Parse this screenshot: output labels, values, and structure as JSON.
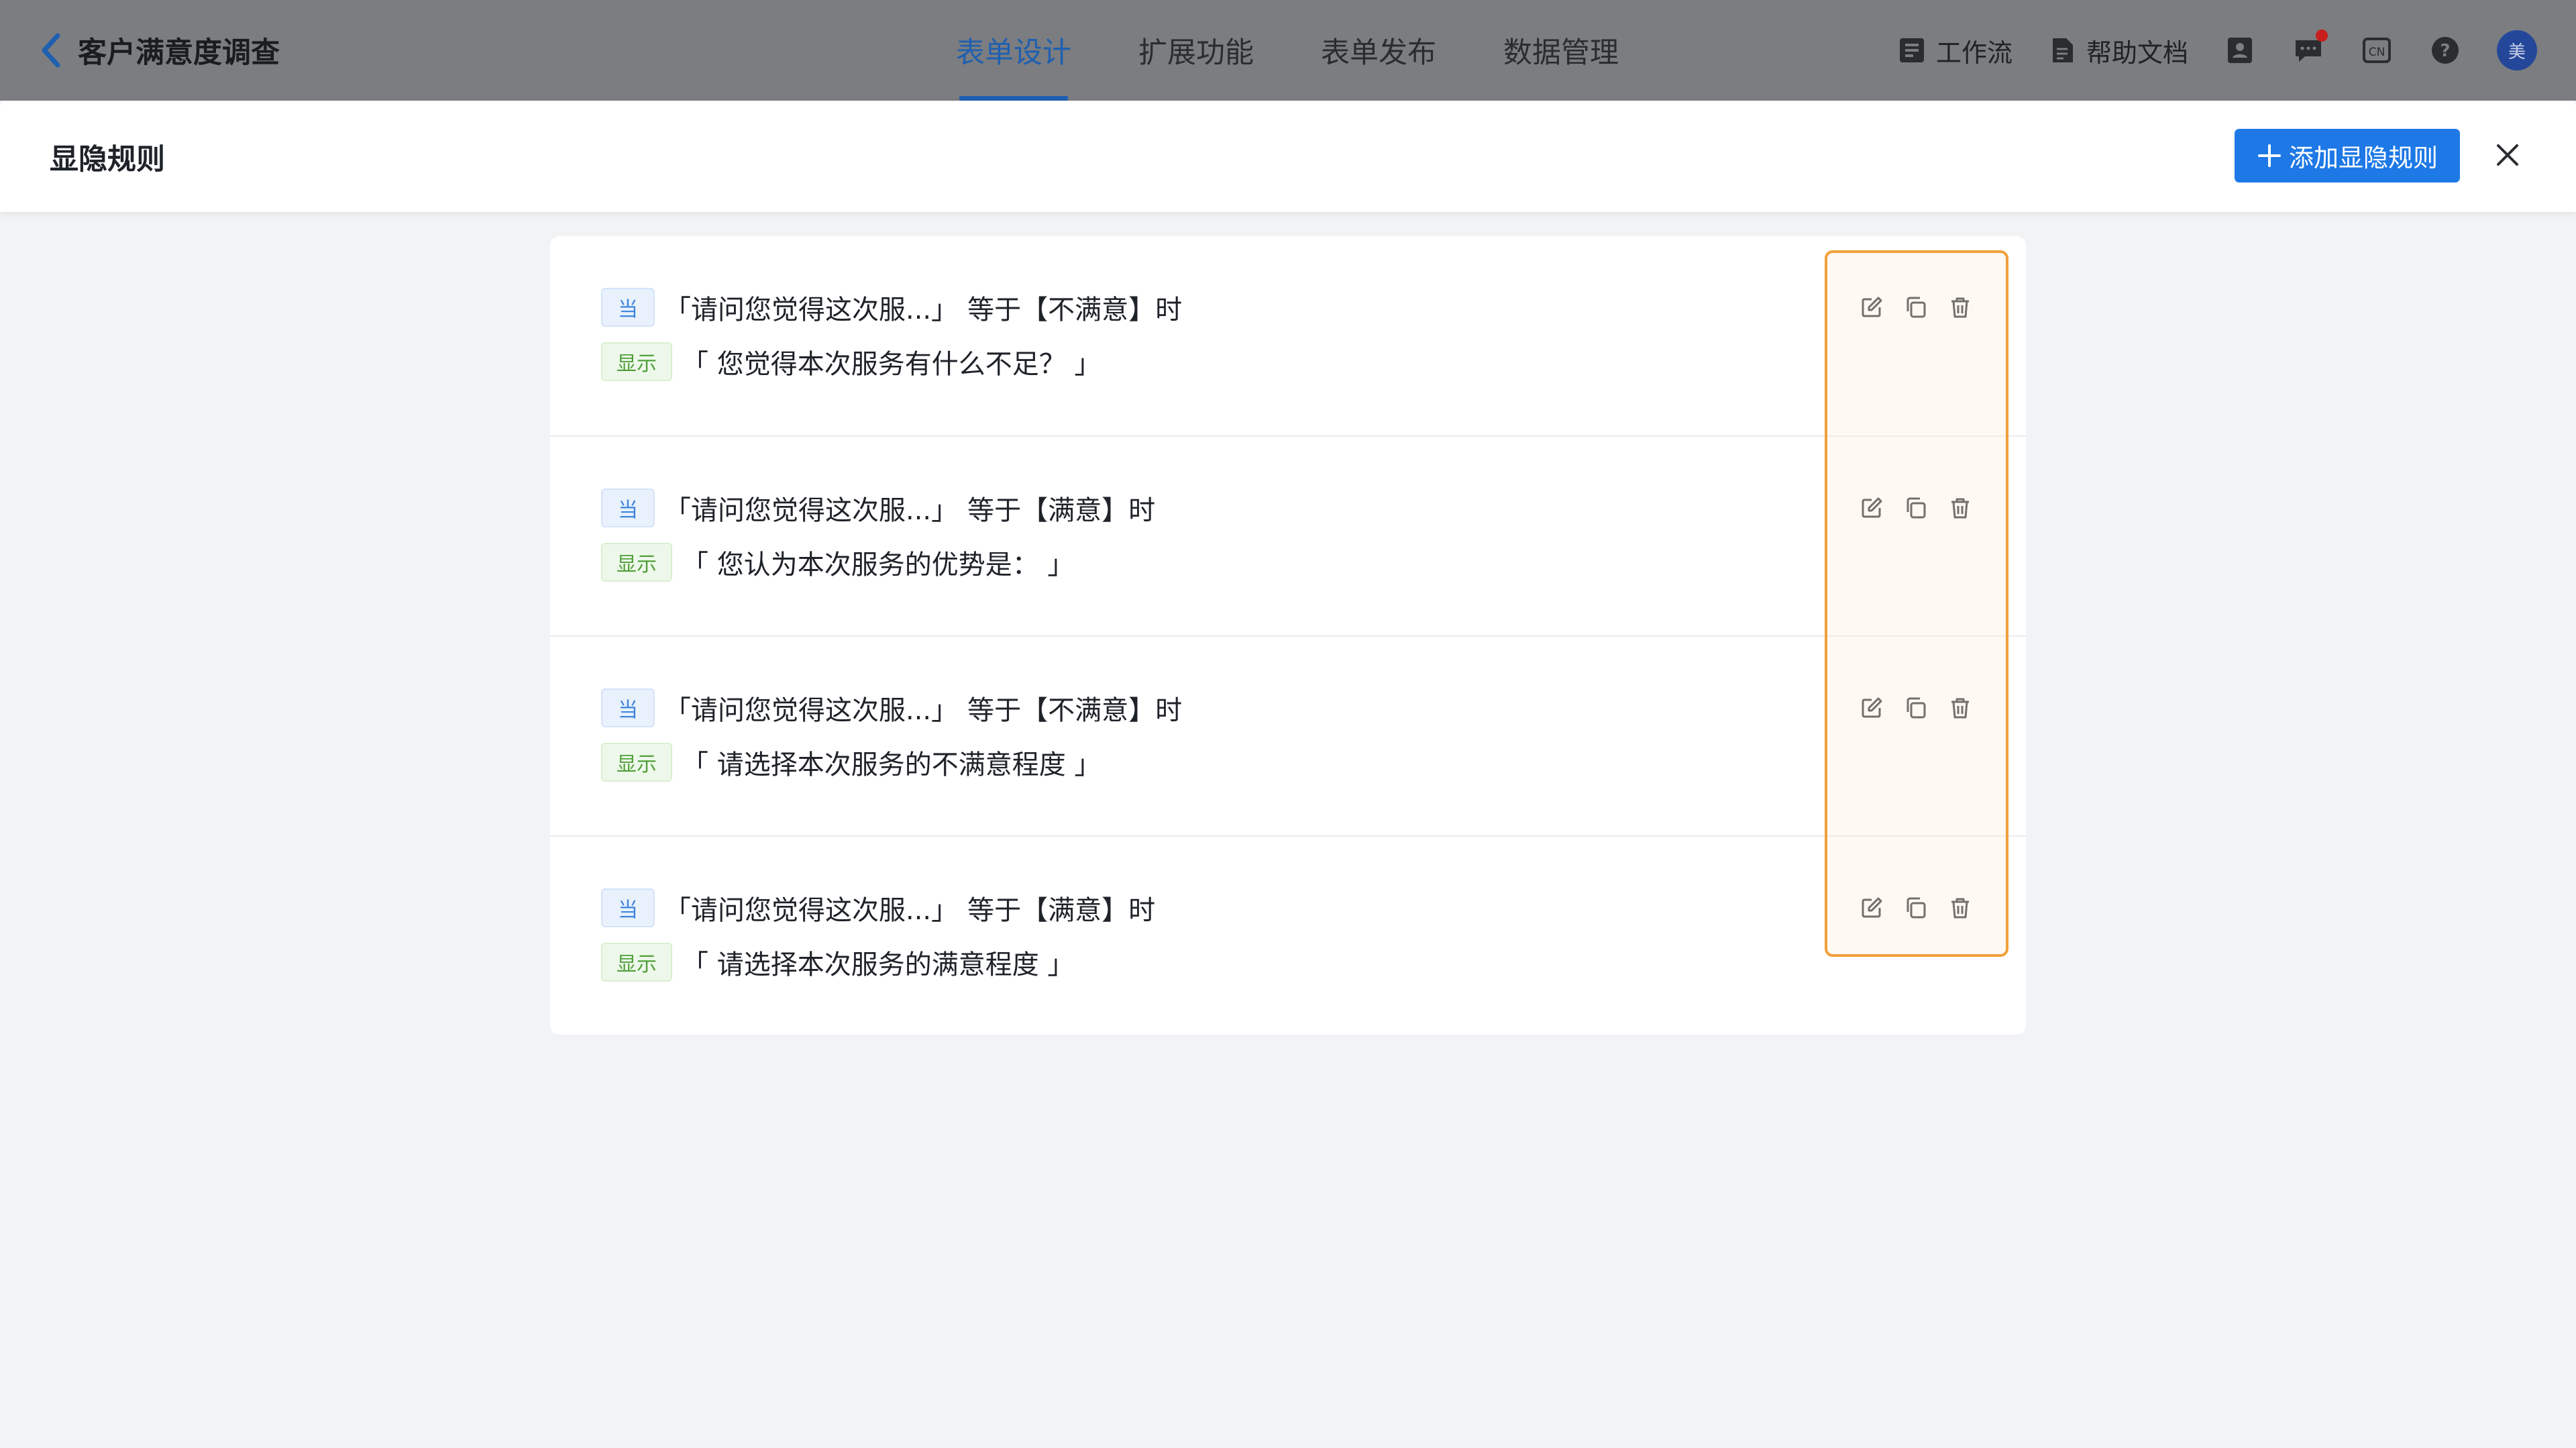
{
  "header": {
    "title": "客户满意度调查",
    "tabs": [
      {
        "label": "表单设计",
        "active": true
      },
      {
        "label": "扩展功能",
        "active": false
      },
      {
        "label": "表单发布",
        "active": false
      },
      {
        "label": "数据管理",
        "active": false
      }
    ],
    "workflow_label": "工作流",
    "help_label": "帮助文档",
    "lang_label": "CN",
    "avatar_label": "美"
  },
  "drawer": {
    "title": "显隐规则",
    "add_button_label": "添加显隐规则"
  },
  "colors": {
    "primary": "#1e79e6",
    "highlight": "#f2a03a",
    "when_tag": "#3f86dd",
    "show_tag": "#4fa03a"
  },
  "rules": [
    {
      "when": "当",
      "field": "「请问您觉得这次服...」",
      "operator": "等于",
      "value": "【不满意】时",
      "show": "显示",
      "target": "「 您觉得本次服务有什么不足？ 」"
    },
    {
      "when": "当",
      "field": "「请问您觉得这次服...」",
      "operator": "等于",
      "value": "【满意】时",
      "show": "显示",
      "target": "「 您认为本次服务的优势是： 」"
    },
    {
      "when": "当",
      "field": "「请问您觉得这次服...」",
      "operator": "等于",
      "value": "【不满意】时",
      "show": "显示",
      "target": "「 请选择本次服务的不满意程度 」"
    },
    {
      "when": "当",
      "field": "「请问您觉得这次服...」",
      "operator": "等于",
      "value": "【满意】时",
      "show": "显示",
      "target": "「 请选择本次服务的满意程度 」"
    }
  ]
}
